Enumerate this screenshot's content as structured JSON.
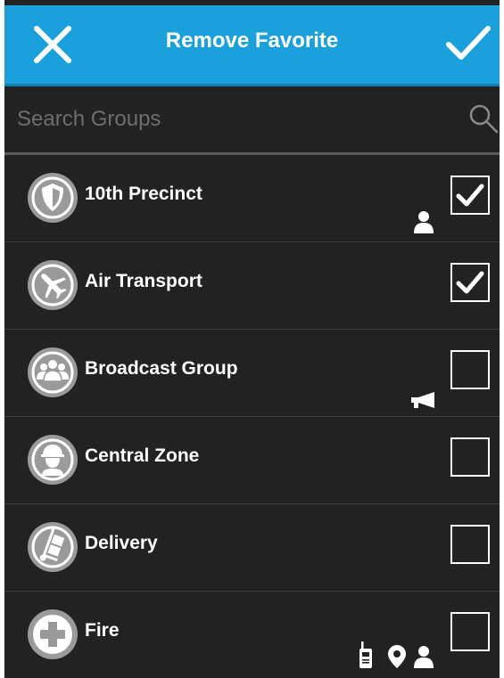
{
  "header": {
    "title": "Remove Favorite",
    "close_icon": "close-icon",
    "confirm_icon": "checkmark-icon",
    "background_color": "#1aa1dc"
  },
  "search": {
    "placeholder": "Search Groups",
    "value": "",
    "icon": "search-icon"
  },
  "groups": [
    {
      "label": "10th Precinct",
      "icon": "shield-icon",
      "checked": true,
      "badges": [
        "person-icon"
      ]
    },
    {
      "label": "Air Transport",
      "icon": "airplane-icon",
      "checked": true,
      "badges": []
    },
    {
      "label": "Broadcast Group",
      "icon": "group-icon",
      "checked": false,
      "badges": [
        "megaphone-icon"
      ]
    },
    {
      "label": "Central Zone",
      "icon": "worker-helmet-icon",
      "checked": false,
      "badges": []
    },
    {
      "label": "Delivery",
      "icon": "hand-truck-icon",
      "checked": false,
      "badges": []
    },
    {
      "label": "Fire",
      "icon": "cross-icon",
      "checked": false,
      "badges": [
        "radio-icon",
        "location-pin-icon",
        "person-icon"
      ]
    }
  ]
}
